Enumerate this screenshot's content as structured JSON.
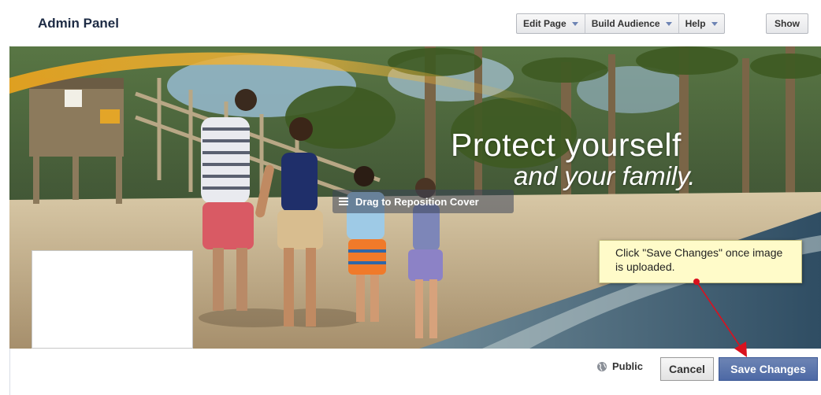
{
  "header": {
    "title": "Admin Panel",
    "menus": [
      {
        "label": "Edit Page"
      },
      {
        "label": "Build Audience"
      },
      {
        "label": "Help"
      }
    ],
    "show_label": "Show"
  },
  "cover": {
    "headline_line1": "Protect yourself",
    "headline_line2": "and your family.",
    "drag_hint": "Drag to Reposition Cover"
  },
  "annotation": {
    "text": "Click \"Save Changes\" once image is uploaded.",
    "arrow_color": "#d9121f"
  },
  "footer": {
    "privacy_label": "Public",
    "cancel_label": "Cancel",
    "save_label": "Save Changes"
  },
  "colors": {
    "accent": "#4d69a5",
    "tooltip_bg": "#fffbc9"
  }
}
